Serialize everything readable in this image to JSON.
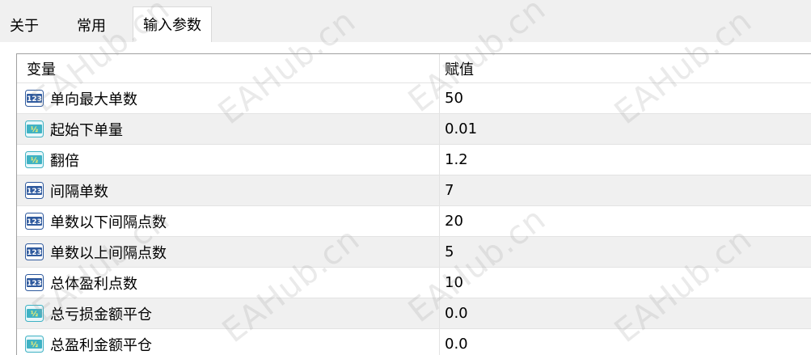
{
  "tabs": [
    {
      "label": "关于",
      "active": false
    },
    {
      "label": "常用",
      "active": false
    },
    {
      "label": "输入参数",
      "active": true
    }
  ],
  "table": {
    "headers": {
      "name": "变量",
      "value": "赋值"
    },
    "rows": [
      {
        "type": "int",
        "icon": "int-123-icon",
        "name": "单向最大单数",
        "value": "50"
      },
      {
        "type": "double",
        "icon": "double-v2-icon",
        "name": "起始下单量",
        "value": "0.01"
      },
      {
        "type": "double",
        "icon": "double-v2-icon",
        "name": "翻倍",
        "value": "1.2"
      },
      {
        "type": "int",
        "icon": "int-123-icon",
        "name": "间隔单数",
        "value": "7"
      },
      {
        "type": "int",
        "icon": "int-123-icon",
        "name": "单数以下间隔点数",
        "value": "20"
      },
      {
        "type": "int",
        "icon": "int-123-icon",
        "name": "单数以上间隔点数",
        "value": "5"
      },
      {
        "type": "int",
        "icon": "int-123-icon",
        "name": "总体盈利点数",
        "value": "10"
      },
      {
        "type": "double",
        "icon": "double-v2-icon",
        "name": "总亏损金额平仓",
        "value": "0.0"
      },
      {
        "type": "double",
        "icon": "double-v2-icon",
        "name": "总盈利金额平仓",
        "value": "0.0"
      }
    ]
  },
  "watermark": {
    "text": "EAHub.cn"
  },
  "colors": {
    "int_icon_fill": "#2f5a9e",
    "double_icon_fill": "#3fb2c4",
    "alt_row": "#f0f0f0",
    "grid_border": "#a0a0a0"
  }
}
